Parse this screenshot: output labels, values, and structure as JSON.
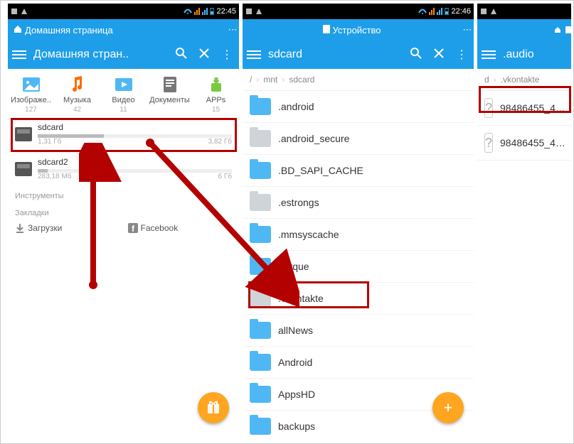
{
  "status": {
    "time1": "22:45",
    "time2": "22:46"
  },
  "panel1": {
    "top_label": "Домашняя страница",
    "title": "Домашняя стран..",
    "cats": [
      {
        "label": "Изображе..",
        "count": "127",
        "color": "#4fb8f4"
      },
      {
        "label": "Музыка",
        "count": "42",
        "color": "#ff6a00"
      },
      {
        "label": "Видео",
        "count": "11",
        "color": "#4fb8f4"
      },
      {
        "label": "Документы",
        "count": "",
        "color": "#777"
      },
      {
        "label": "APPs",
        "count": "15",
        "color": "#7ac943"
      }
    ],
    "storage": [
      {
        "name": "sdcard",
        "used": "1,31 Гб",
        "total": "3,82 Гб",
        "pct": 34
      },
      {
        "name": "sdcard2",
        "used": "283,18 Мб",
        "total": "6 Гб",
        "pct": 5
      }
    ],
    "sec1": "Инструменты",
    "sec2": "Закладки",
    "bm1": "Загрузки",
    "bm2": "Facebook"
  },
  "panel2": {
    "top_label": "Устройство",
    "title": "sdcard",
    "crumbs": [
      "/",
      "mnt",
      "sdcard"
    ],
    "folders": [
      {
        "name": ".android",
        "style": "fblue"
      },
      {
        "name": ".android_secure",
        "style": "fgrey"
      },
      {
        "name": ".BD_SAPI_CACHE",
        "style": "fblue"
      },
      {
        "name": ".estrongs",
        "style": "fgrey"
      },
      {
        "name": ".mmsyscache",
        "style": "fblue"
      },
      {
        "name": ".torque",
        "style": "fblue"
      },
      {
        "name": ".vkontakte",
        "style": "fgrey"
      },
      {
        "name": "allNews",
        "style": "fblue"
      },
      {
        "name": "Android",
        "style": "fblue"
      },
      {
        "name": "AppsHD",
        "style": "fblue"
      },
      {
        "name": "backups",
        "style": "fblue"
      }
    ]
  },
  "panel3": {
    "top_label": "",
    "title": ".audio",
    "crumbs": [
      "d",
      ".vkontakte"
    ],
    "files": [
      {
        "name": "98486455_4…"
      },
      {
        "name": "98486455_4…"
      }
    ]
  }
}
